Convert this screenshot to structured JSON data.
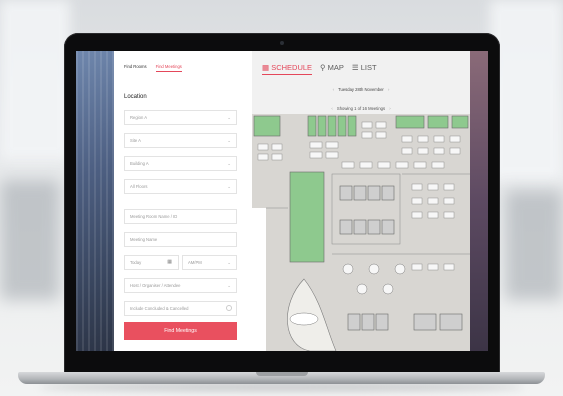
{
  "sidebar": {
    "tabs": [
      {
        "label": "Find Rooms",
        "active": false
      },
      {
        "label": "Find Meetings",
        "active": true
      }
    ],
    "location_label": "Location",
    "fields": {
      "region": "Region A",
      "site": "Site A",
      "building": "Building A",
      "floors": "All Floors",
      "meeting_room": "Meeting Room Name / ID",
      "meeting_name": "Meeting Name",
      "date": "Today",
      "time": "AM/PM",
      "host": "Host / Organiser / Attendee",
      "include": "Include Concluded & Cancelled"
    },
    "find_button": "Find Meetings"
  },
  "view_tabs": [
    {
      "icon": "calendar-icon",
      "label": "SCHEDULE",
      "active": true
    },
    {
      "icon": "map-pin-icon",
      "label": "MAP",
      "active": false
    },
    {
      "icon": "list-icon",
      "label": "LIST",
      "active": false
    }
  ],
  "date_label": "Tuesday 28th November",
  "showing_label": "Showing 1 of 16 Meetings",
  "colors": {
    "accent": "#e4475a",
    "button": "#e9505f",
    "room_available": "#8ec98e",
    "floor": "#d8d6d2"
  }
}
